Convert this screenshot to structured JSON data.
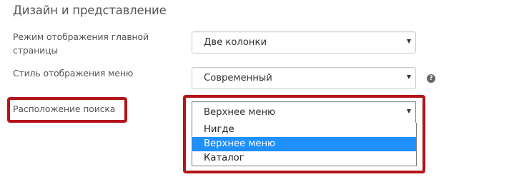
{
  "section": {
    "title": "Дизайн и представление"
  },
  "fields": {
    "main_page_mode": {
      "label": "Режим отображения главной страницы",
      "value": "Две колонки"
    },
    "menu_style": {
      "label": "Стиль отображения меню",
      "value": "Современный",
      "help_icon": "?"
    },
    "search_location": {
      "label": "Расположение поиска",
      "value": "Верхнее меню",
      "options": [
        "Нигде",
        "Верхнее меню",
        "Каталог"
      ],
      "selected_index": 1
    }
  },
  "colors": {
    "highlight_border": "#b3151a",
    "option_selected_bg": "#1e90ff"
  }
}
